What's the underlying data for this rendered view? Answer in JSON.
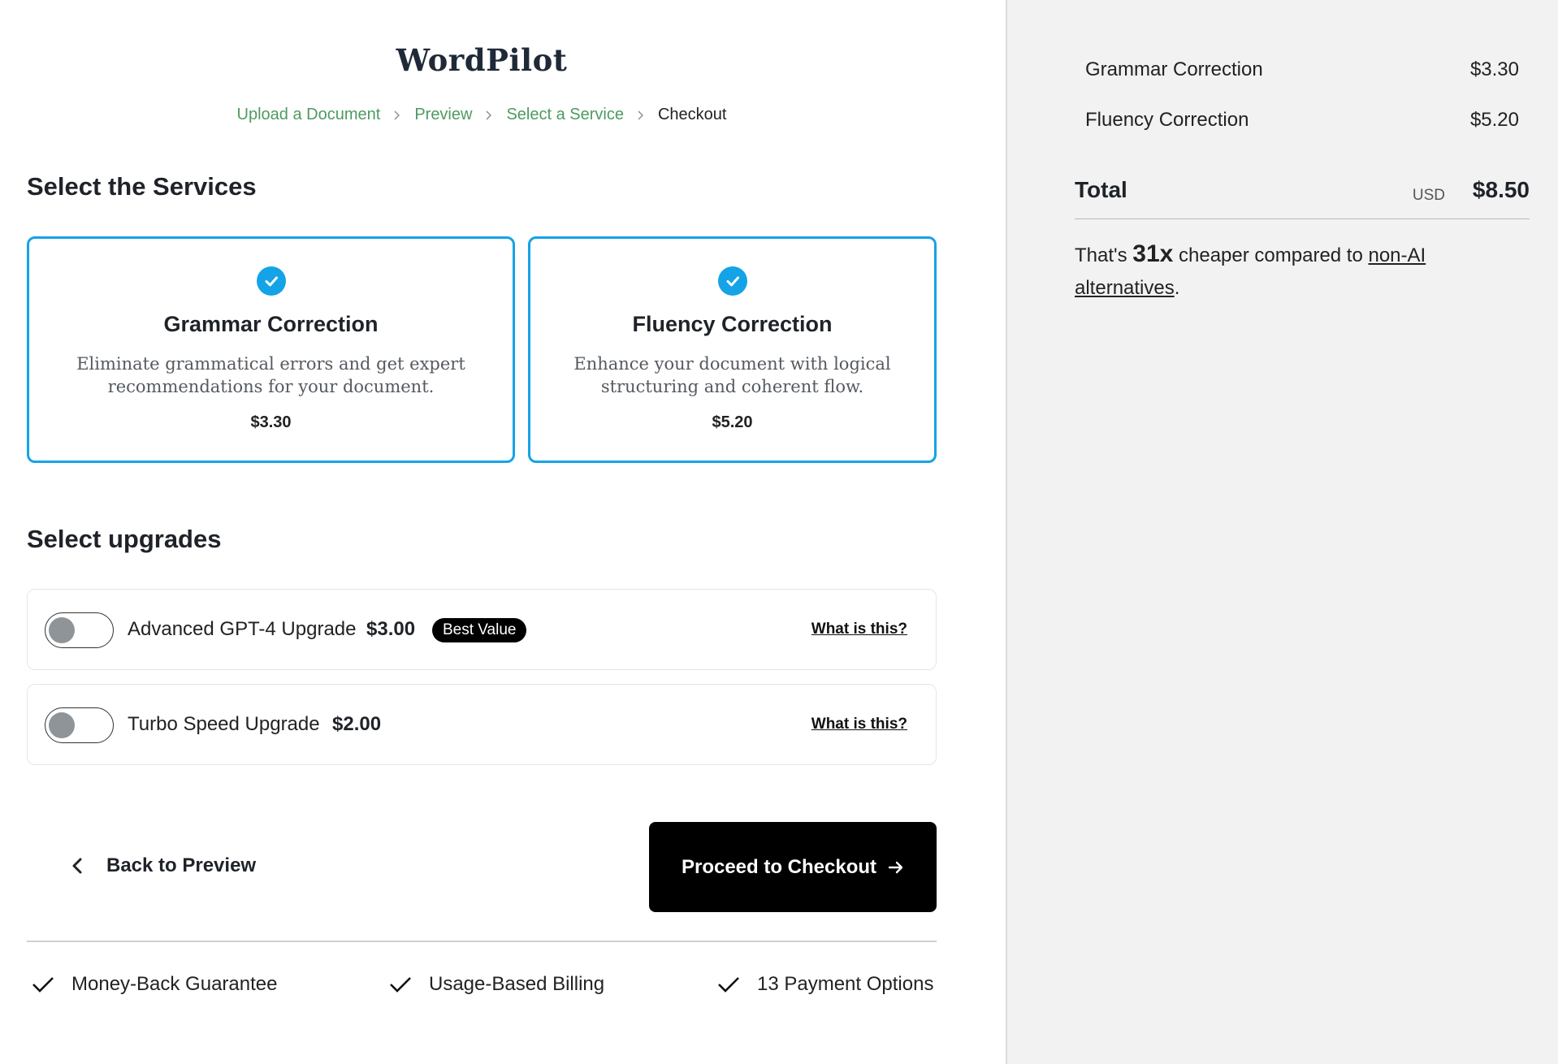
{
  "brand": {
    "name": "WordPilot"
  },
  "breadcrumb": [
    {
      "label": "Upload a Document"
    },
    {
      "label": "Preview"
    },
    {
      "label": "Select a Service"
    },
    {
      "label": "Checkout"
    }
  ],
  "services": {
    "title": "Select the Services",
    "cards": [
      {
        "title": "Grammar Correction",
        "description": "Eliminate grammatical errors and get expert recommendations for your document.",
        "price": "$3.30",
        "selected": true
      },
      {
        "title": "Fluency Correction",
        "description": "Enhance your document with logical structuring and coherent flow.",
        "price": "$5.20",
        "selected": true
      }
    ]
  },
  "upgrades": {
    "title": "Select upgrades",
    "items": [
      {
        "label": "Advanced GPT-4 Upgrade",
        "price": "$3.00",
        "badge": "Best Value",
        "help": "What is this?",
        "enabled": false
      },
      {
        "label": "Turbo Speed Upgrade",
        "price": "$2.00",
        "help": "What is this?",
        "enabled": false
      }
    ]
  },
  "actions": {
    "back": "Back to Preview",
    "proceed": "Proceed to Checkout"
  },
  "features": [
    "Money-Back Guarantee",
    "Usage-Based Billing",
    "13 Payment Options"
  ],
  "summary": {
    "lines": [
      {
        "label": "Grammar Correction",
        "amount": "$3.30"
      },
      {
        "label": "Fluency Correction",
        "amount": "$5.20"
      }
    ],
    "total_label": "Total",
    "currency": "USD",
    "total": "$8.50",
    "savings": {
      "prefix": "That's ",
      "multiplier": "31x",
      "middle": " cheaper compared to ",
      "link": "non-AI alternatives",
      "suffix": "."
    }
  },
  "colors": {
    "accent": "#14a3e6",
    "breadcrumb_link": "#4e9a62",
    "button_bg": "#000000",
    "sidebar_bg": "#f2f2f2"
  }
}
